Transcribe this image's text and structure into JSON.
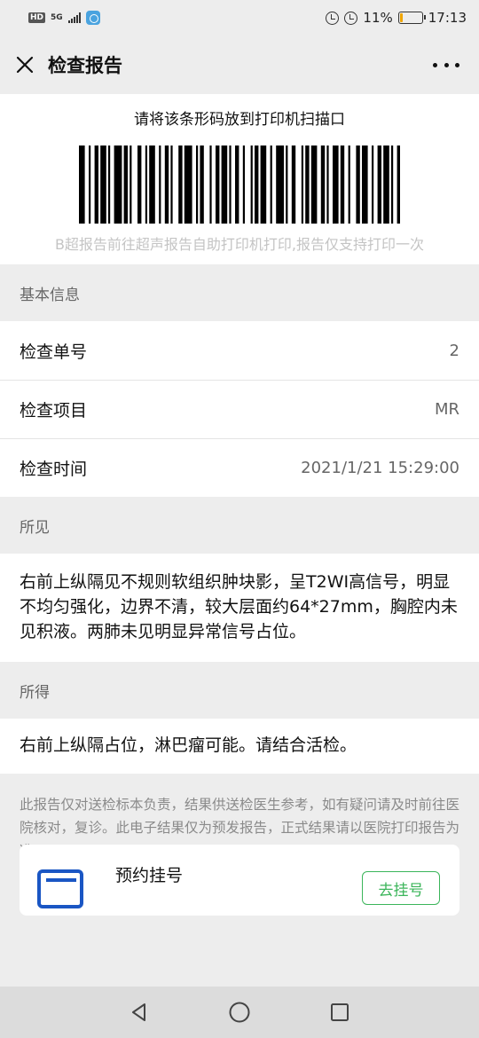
{
  "status_bar": {
    "left_badge": "HD",
    "network": "5G",
    "battery_percent": "11%",
    "battery_level": 0.11,
    "time": "17:13"
  },
  "navbar": {
    "title": "检查报告",
    "close_icon": "close-icon",
    "more_icon": "more-icon"
  },
  "barcode": {
    "instruction": "请将该条形码放到打印机扫描口",
    "note": "B超报告前往超声报告自助打印机打印,报告仅支持打印一次"
  },
  "basic_info": {
    "heading": "基本信息",
    "rows": [
      {
        "label": "检查单号",
        "value": "2"
      },
      {
        "label": "检查项目",
        "value": "MR"
      },
      {
        "label": "检查时间",
        "value": "2021/1/21 15:29:00"
      }
    ]
  },
  "findings": {
    "heading": "所见",
    "text": "右前上纵隔见不规则软组织肿块影，呈T2WI高信号，明显不均匀强化，边界不清，较大层面约64*27mm，胸腔内未见积液。两肺未见明显异常信号占位。"
  },
  "conclusion": {
    "heading": "所得",
    "text": "右前上纵隔占位，淋巴瘤可能。请结合活检。"
  },
  "disclaimer": "此报告仅对送检标本负责，结果供送检医生参考，如有疑问请及时前往医院核对，复诊。此电子结果仅为预发报告，正式结果请以医院打印报告为准。",
  "appointment": {
    "title": "预约挂号",
    "button": "去挂号",
    "icon": "calendar-icon"
  },
  "system_nav": {
    "back_icon": "back-triangle-icon",
    "home_icon": "home-circle-icon",
    "recents_icon": "recents-square-icon"
  },
  "colors": {
    "background": "#ededed",
    "accent_green": "#3bb55a",
    "icon_blue": "#1a56c4",
    "battery": "#f0a500"
  }
}
